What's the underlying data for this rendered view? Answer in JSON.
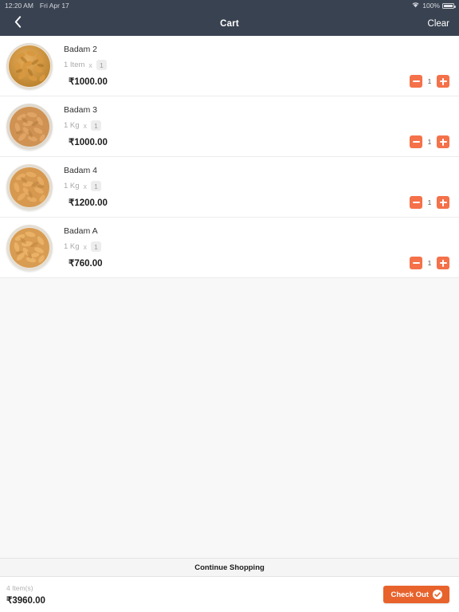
{
  "status_bar": {
    "time": "12:20 AM",
    "date": "Fri Apr 17",
    "battery_percent": "100%",
    "wifi_icon": "wifi-icon",
    "battery_icon": "battery-full-icon"
  },
  "nav": {
    "back_icon": "chevron-left-icon",
    "title": "Cart",
    "clear_label": "Clear"
  },
  "colors": {
    "header_bg": "#394251",
    "accent_orange": "#f4714a",
    "checkout_orange": "#e8622c",
    "page_bg": "#f8f8f8",
    "muted_text": "#a9a9a9"
  },
  "cart": {
    "items": [
      {
        "name": "Badam 2",
        "unit": "1 Item",
        "times": "x",
        "quantity_badge": "1",
        "price": "₹1000.00",
        "stepper_value": "1",
        "minus_icon": "minus-icon",
        "plus_icon": "plus-icon",
        "thumbnail_icon": "bowl-of-almonds-image",
        "bowl_tone": "#c98a33",
        "nut_tone": "#e0a351",
        "nut_tone_2": "#c8862f"
      },
      {
        "name": "Badam 3",
        "unit": "1 Kg",
        "times": "x",
        "quantity_badge": "1",
        "price": "₹1000.00",
        "stepper_value": "1",
        "minus_icon": "minus-icon",
        "plus_icon": "plus-icon",
        "thumbnail_icon": "bowl-of-almonds-image",
        "bowl_tone": "#d7cec2",
        "nut_tone": "#d59659",
        "nut_tone_2": "#b87a3d"
      },
      {
        "name": "Badam 4",
        "unit": "1 Kg",
        "times": "x",
        "quantity_badge": "1",
        "price": "₹1200.00",
        "stepper_value": "1",
        "minus_icon": "minus-icon",
        "plus_icon": "plus-icon",
        "thumbnail_icon": "bowl-of-almonds-image",
        "bowl_tone": "#ded6cb",
        "nut_tone": "#dc9a55",
        "nut_tone_2": "#bd7f3c"
      },
      {
        "name": "Badam A",
        "unit": "1 Kg",
        "times": "x",
        "quantity_badge": "1",
        "price": "₹760.00",
        "stepper_value": "1",
        "minus_icon": "minus-icon",
        "plus_icon": "plus-icon",
        "thumbnail_icon": "bowl-of-almonds-image",
        "bowl_tone": "#e2dbd1",
        "nut_tone": "#e2a259",
        "nut_tone_2": "#c0803b"
      }
    ]
  },
  "footer": {
    "continue_label": "Continue Shopping",
    "item_count": "4 Item(s)",
    "total": "₹3960.00",
    "checkout_label": "Check Out",
    "checkout_icon": "check-circle-icon"
  }
}
